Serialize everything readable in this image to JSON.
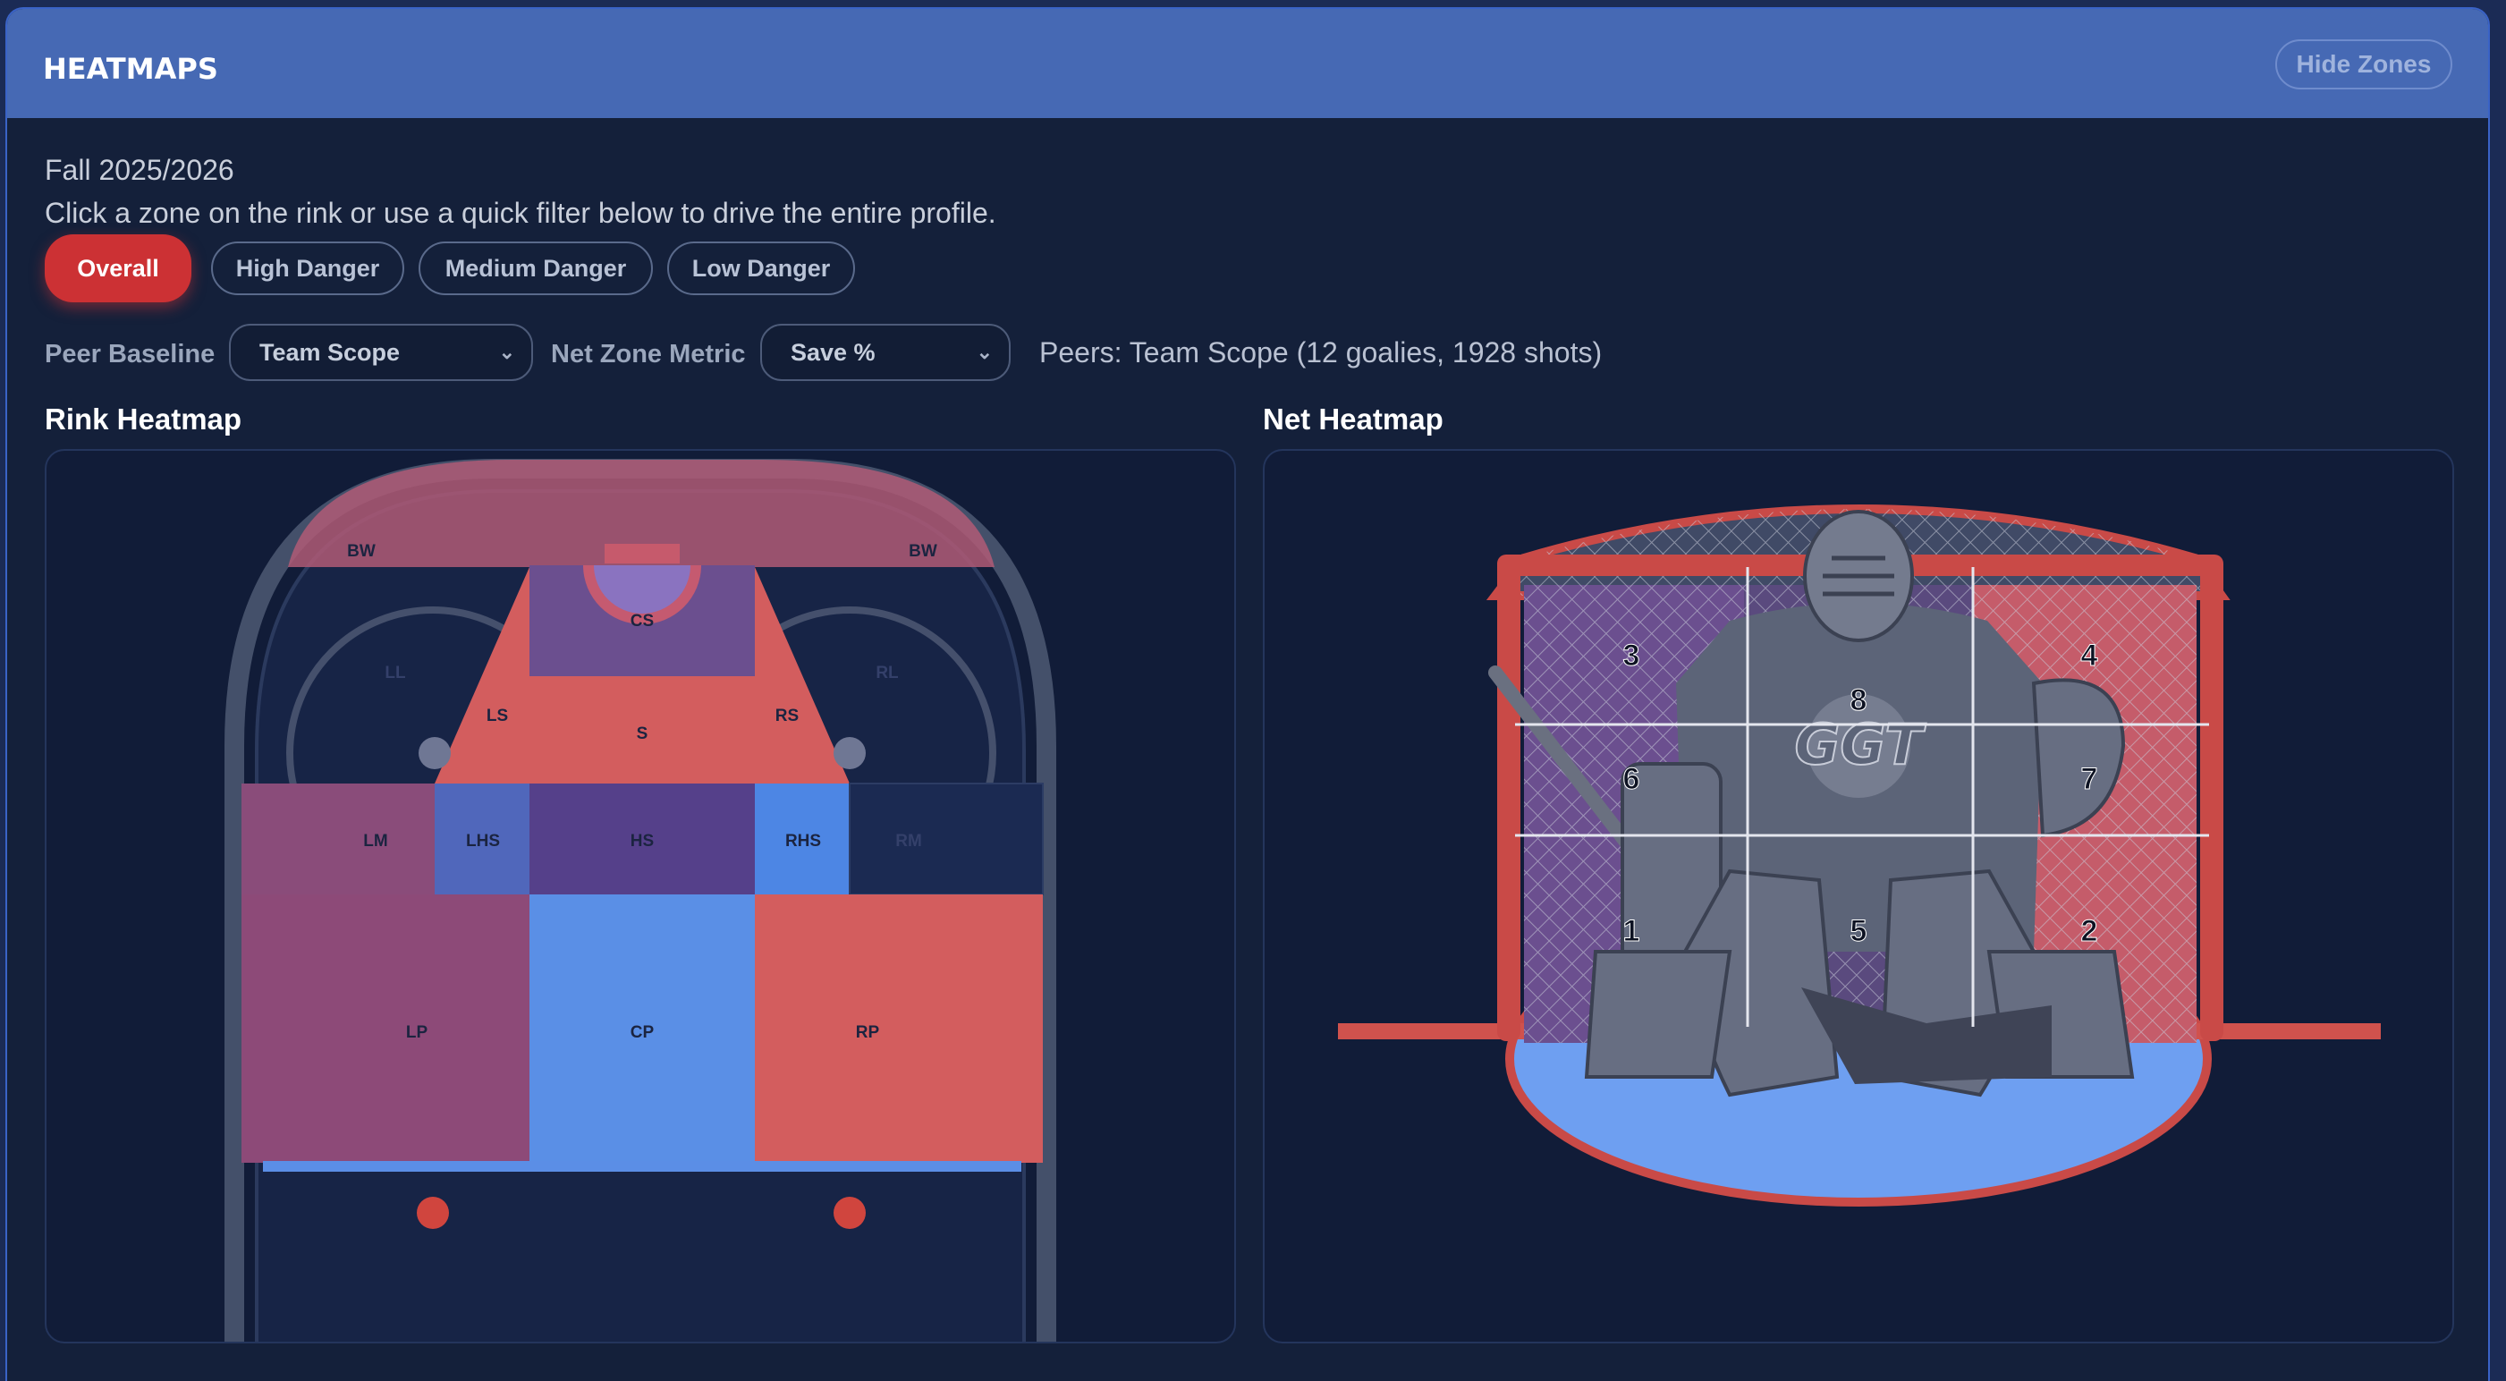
{
  "header": {
    "title": "HEATMAPS",
    "hide_zones_label": "Hide Zones"
  },
  "season": "Fall 2025/2026",
  "instructions": "Click a zone on the rink or use a quick filter below to drive the entire profile.",
  "filters": [
    "Overall",
    "High Danger",
    "Medium Danger",
    "Low Danger"
  ],
  "active_filter": "Overall",
  "peer_baseline": {
    "label": "Peer Baseline",
    "value": "Team Scope"
  },
  "net_zone_metric": {
    "label": "Net Zone Metric",
    "value": "Save %"
  },
  "peers_text": "Peers: Team Scope (12 goalies, 1928 shots)",
  "rink": {
    "title": "Rink Heatmap",
    "zones": {
      "BW_L": "BW",
      "BW_R": "BW",
      "CS": "CS",
      "LL": "LL",
      "RL": "RL",
      "LS": "LS",
      "S": "S",
      "RS": "RS",
      "LM": "LM",
      "LHS": "LHS",
      "HS": "HS",
      "RHS": "RHS",
      "RM": "RM",
      "LP": "LP",
      "CP": "CP",
      "RP": "RP"
    }
  },
  "net": {
    "title": "Net Heatmap",
    "logo_text": "GGT",
    "zones": {
      "z1": "1",
      "z2": "2",
      "z3": "3",
      "z4": "4",
      "z5": "5",
      "z6": "6",
      "z7": "7",
      "z8": "8"
    }
  },
  "colors": {
    "red": "#d85c5c",
    "blue": "#5b8ee6",
    "purple": "#6a4f96",
    "mauve": "#8c4e7a",
    "header": "#4669b4",
    "active_chip": "#cc3134"
  }
}
